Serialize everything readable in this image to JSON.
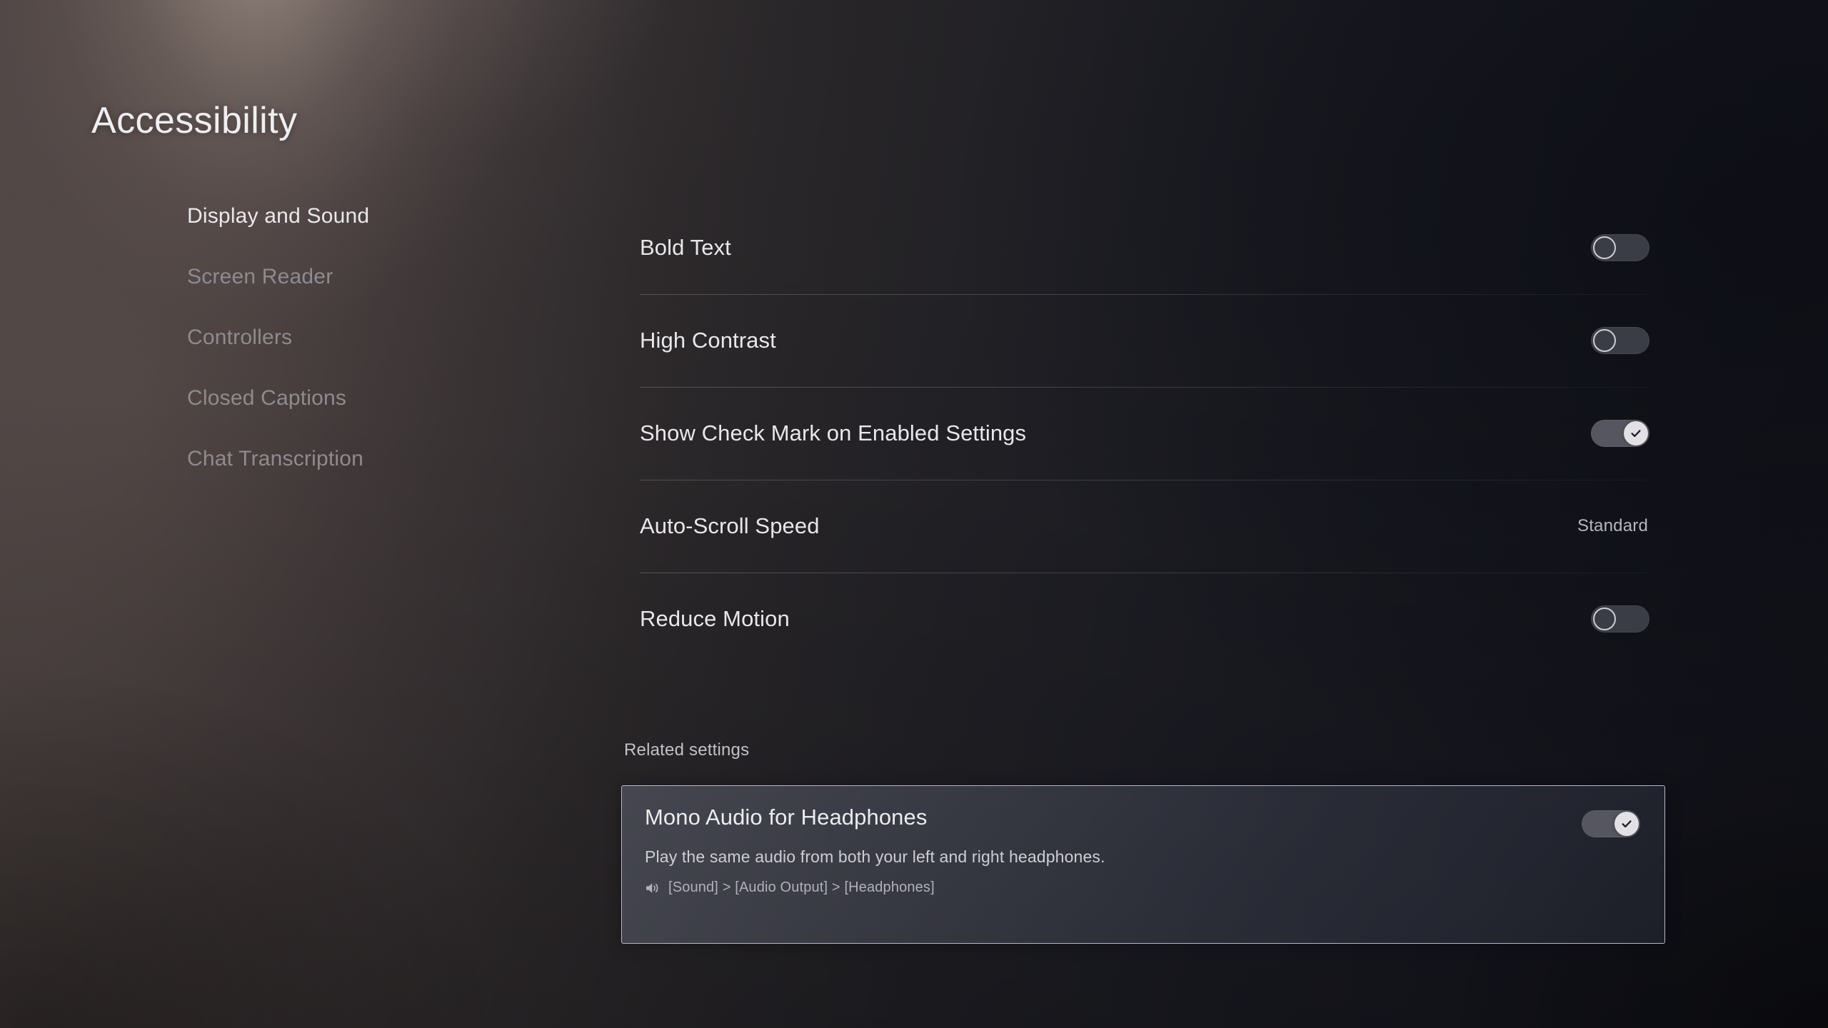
{
  "page": {
    "title": "Accessibility"
  },
  "sidebar": {
    "items": [
      {
        "label": "Display and Sound",
        "state": "active"
      },
      {
        "label": "Screen Reader",
        "state": "inactive"
      },
      {
        "label": "Controllers",
        "state": "inactive"
      },
      {
        "label": "Closed Captions",
        "state": "inactive"
      },
      {
        "label": "Chat Transcription",
        "state": "inactive"
      }
    ]
  },
  "settings": {
    "rows": [
      {
        "label": "Bold Text",
        "control": "toggle",
        "value": "off"
      },
      {
        "label": "High Contrast",
        "control": "toggle",
        "value": "off"
      },
      {
        "label": "Show Check Mark on Enabled Settings",
        "control": "toggle",
        "value": "on"
      },
      {
        "label": "Auto-Scroll Speed",
        "control": "value",
        "value": "Standard"
      },
      {
        "label": "Reduce Motion",
        "control": "toggle",
        "value": "off"
      }
    ]
  },
  "related": {
    "section_label": "Related settings",
    "card": {
      "title": "Mono Audio for Headphones",
      "description": "Play the same audio from both your left and right headphones.",
      "path_icon": "speaker-volume-icon",
      "path": "[Sound] > [Audio Output] > [Headphones]",
      "toggle_value": "on",
      "focused": true
    }
  },
  "colors": {
    "text_primary": "#e9e8ec",
    "text_dimmed": "#8e8b90",
    "text_secondary": "#b8b6bd",
    "toggle_off_track": "#3b3d46",
    "toggle_on_track": "#55565f",
    "toggle_on_knob": "#e3e1e6",
    "card_border_focus": "#b9b6cb",
    "background_right": "#13141c"
  }
}
